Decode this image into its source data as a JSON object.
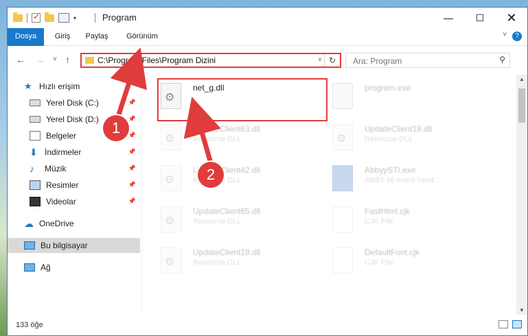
{
  "window": {
    "title": "Program",
    "controls": {
      "minimize": "—",
      "maximize": "☐",
      "close": "✕"
    }
  },
  "ribbon": {
    "tabs": [
      "Dosya",
      "Giriş",
      "Paylaş",
      "Görünüm"
    ],
    "help": "?"
  },
  "navbar": {
    "back": "←",
    "forward": "→",
    "recent": "˅",
    "up": "↑",
    "address": "C:\\Program Files\\Program Dizini",
    "search_placeholder": "Ara: Program"
  },
  "sidebar": {
    "items": [
      {
        "label": "Hızlı erişim",
        "icon": "star-icon"
      },
      {
        "label": "Yerel Disk (C:)",
        "icon": "drive-icon",
        "pinned": true
      },
      {
        "label": "Yerel Disk (D:)",
        "icon": "drive-icon",
        "pinned": true
      },
      {
        "label": "Belgeler",
        "icon": "documents-icon",
        "pinned": true
      },
      {
        "label": "İndirmeler",
        "icon": "download-icon",
        "pinned": true
      },
      {
        "label": "Müzik",
        "icon": "music-icon",
        "pinned": true
      },
      {
        "label": "Resimler",
        "icon": "pictures-icon",
        "pinned": true
      },
      {
        "label": "Videolar",
        "icon": "videos-icon",
        "pinned": true
      },
      {
        "label": "OneDrive",
        "icon": "cloud-icon"
      },
      {
        "label": "Bu bilgisayar",
        "icon": "computer-icon",
        "selected": true
      },
      {
        "label": "Ağ",
        "icon": "network-icon"
      }
    ]
  },
  "files": [
    {
      "name": "net_g.dll",
      "sub": ""
    },
    {
      "name": "program.exe",
      "sub": ""
    },
    {
      "name": "UpdateClient63.dll",
      "sub": "Resource DLL"
    },
    {
      "name": "UpdateClient19.dll",
      "sub": "Resource DLL"
    },
    {
      "name": "UpdateClient42.dll",
      "sub": "Resource DLL"
    },
    {
      "name": "AbbyySTI.exe",
      "sub": "ABBY sti event hand..."
    },
    {
      "name": "UpdateClient65.dll",
      "sub": "Resource DLL"
    },
    {
      "name": "FastHtml.cjk",
      "sub": "CJK File"
    },
    {
      "name": "UpdateClient19.dll",
      "sub": "Resource DLL"
    },
    {
      "name": "DefaultFont.cjk",
      "sub": "CJK File"
    }
  ],
  "callouts": [
    "1",
    "2"
  ],
  "status": {
    "count": "133 öğe"
  },
  "colors": {
    "accent": "#1979ca",
    "highlight": "#e03c3c"
  }
}
